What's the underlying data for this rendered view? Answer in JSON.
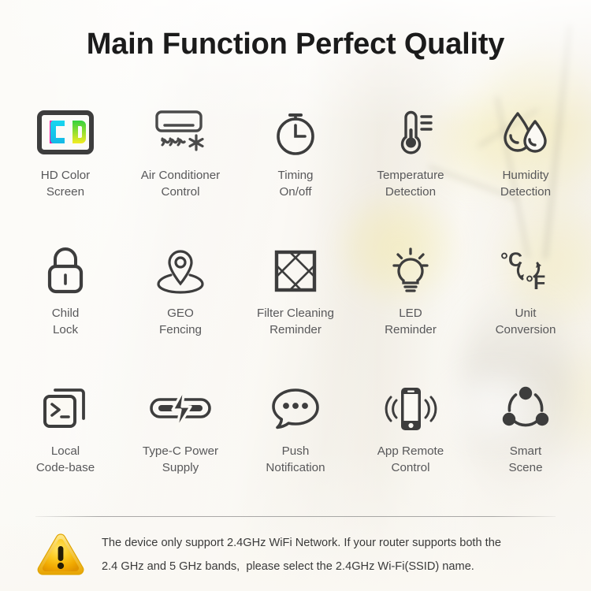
{
  "header": {
    "title": "Main Function Perfect Quality"
  },
  "features": [
    {
      "icon": "led-screen-icon",
      "label": "HD Color\nScreen"
    },
    {
      "icon": "air-conditioner-icon",
      "label": "Air Conditioner\nControl"
    },
    {
      "icon": "stopwatch-timer-icon",
      "label": "Timing\nOn/off"
    },
    {
      "icon": "thermometer-icon",
      "label": "Temperature\nDetection"
    },
    {
      "icon": "water-droplets-icon",
      "label": "Humidity\nDetection"
    },
    {
      "icon": "padlock-icon",
      "label": "Child\nLock"
    },
    {
      "icon": "map-pin-icon",
      "label": "GEO\nFencing"
    },
    {
      "icon": "filter-mesh-icon",
      "label": "Filter Cleaning\nReminder"
    },
    {
      "icon": "light-bulb-icon",
      "label": "LED\nReminder"
    },
    {
      "icon": "celsius-fahrenheit-icon",
      "label": "Unit\nConversion"
    },
    {
      "icon": "terminal-window-icon",
      "label": "Local\nCode-base"
    },
    {
      "icon": "usb-c-bolt-icon",
      "label": "Type-C Power\nSupply"
    },
    {
      "icon": "speech-bubble-icon",
      "label": "Push\nNotification"
    },
    {
      "icon": "smartphone-signal-icon",
      "label": "App Remote\nControl"
    },
    {
      "icon": "share-nodes-icon",
      "label": "Smart\nScene"
    }
  ],
  "footer": {
    "warning_icon": "warning-triangle-icon",
    "line1": "The device only support 2.4GHz WiFi Network. If your router supports both the",
    "line2": "2.4 GHz and 5 GHz bands,  please select the 2.4GHz Wi-Fi(SSID) name."
  },
  "colors": {
    "icon_stroke": "#3d3d3d",
    "caption_text": "#58585a",
    "title_text": "#1b1b1b",
    "warning_gold": "#f0b400",
    "warning_gold_light": "#ffd83b",
    "led_magenta": "#ef1a9a",
    "led_cyan": "#16c8e8",
    "led_green": "#3fd14a",
    "led_yellow": "#f2ea22",
    "background": "#f8f6f1"
  }
}
